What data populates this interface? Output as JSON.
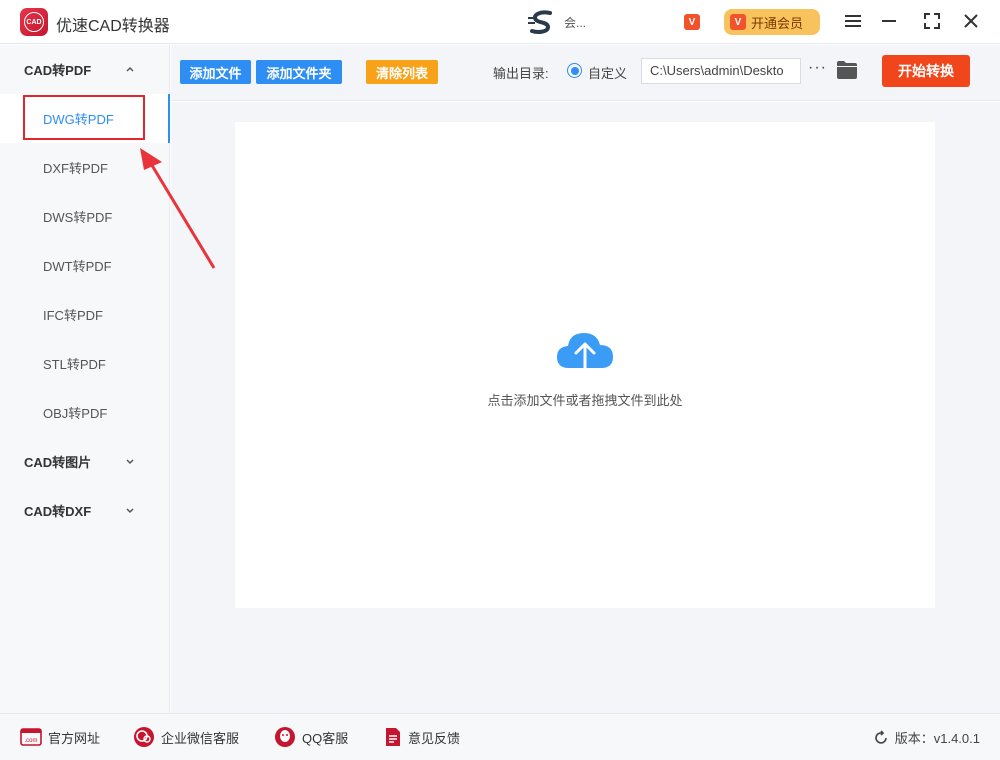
{
  "titlebar": {
    "logo_text": "CAD",
    "app_title": "优速CAD转换器",
    "user_name": "会...",
    "vip_badge": "V",
    "vip_button": "开通会员"
  },
  "sidebar": {
    "groups": [
      {
        "label": "CAD转PDF",
        "expanded": true
      },
      {
        "label": "CAD转图片",
        "expanded": false
      },
      {
        "label": "CAD转DXF",
        "expanded": false
      }
    ],
    "items": [
      {
        "label": "DWG转PDF",
        "active": true
      },
      {
        "label": "DXF转PDF"
      },
      {
        "label": "DWS转PDF"
      },
      {
        "label": "DWT转PDF"
      },
      {
        "label": "IFC转PDF"
      },
      {
        "label": "STL转PDF"
      },
      {
        "label": "OBJ转PDF"
      }
    ]
  },
  "toolbar": {
    "add_file": "添加文件",
    "add_folder": "添加文件夹",
    "clear_list": "清除列表",
    "output_label": "输出目录:",
    "custom_label": "自定义",
    "output_path": "C:\\Users\\admin\\Deskto",
    "more": "···",
    "start": "开始转换"
  },
  "main": {
    "drop_hint": "点击添加文件或者拖拽文件到此处"
  },
  "footer": {
    "website": "官方网址",
    "wechat": "企业微信客服",
    "qq": "QQ客服",
    "feedback": "意见反馈",
    "version": "版本：v1.4.0.1"
  },
  "colors": {
    "accent_blue": "#2f8ef4",
    "orange": "#f8a21a",
    "start_red": "#f1461c",
    "annotation_red": "#e3262b",
    "vip_gold": "#f8c25c"
  }
}
